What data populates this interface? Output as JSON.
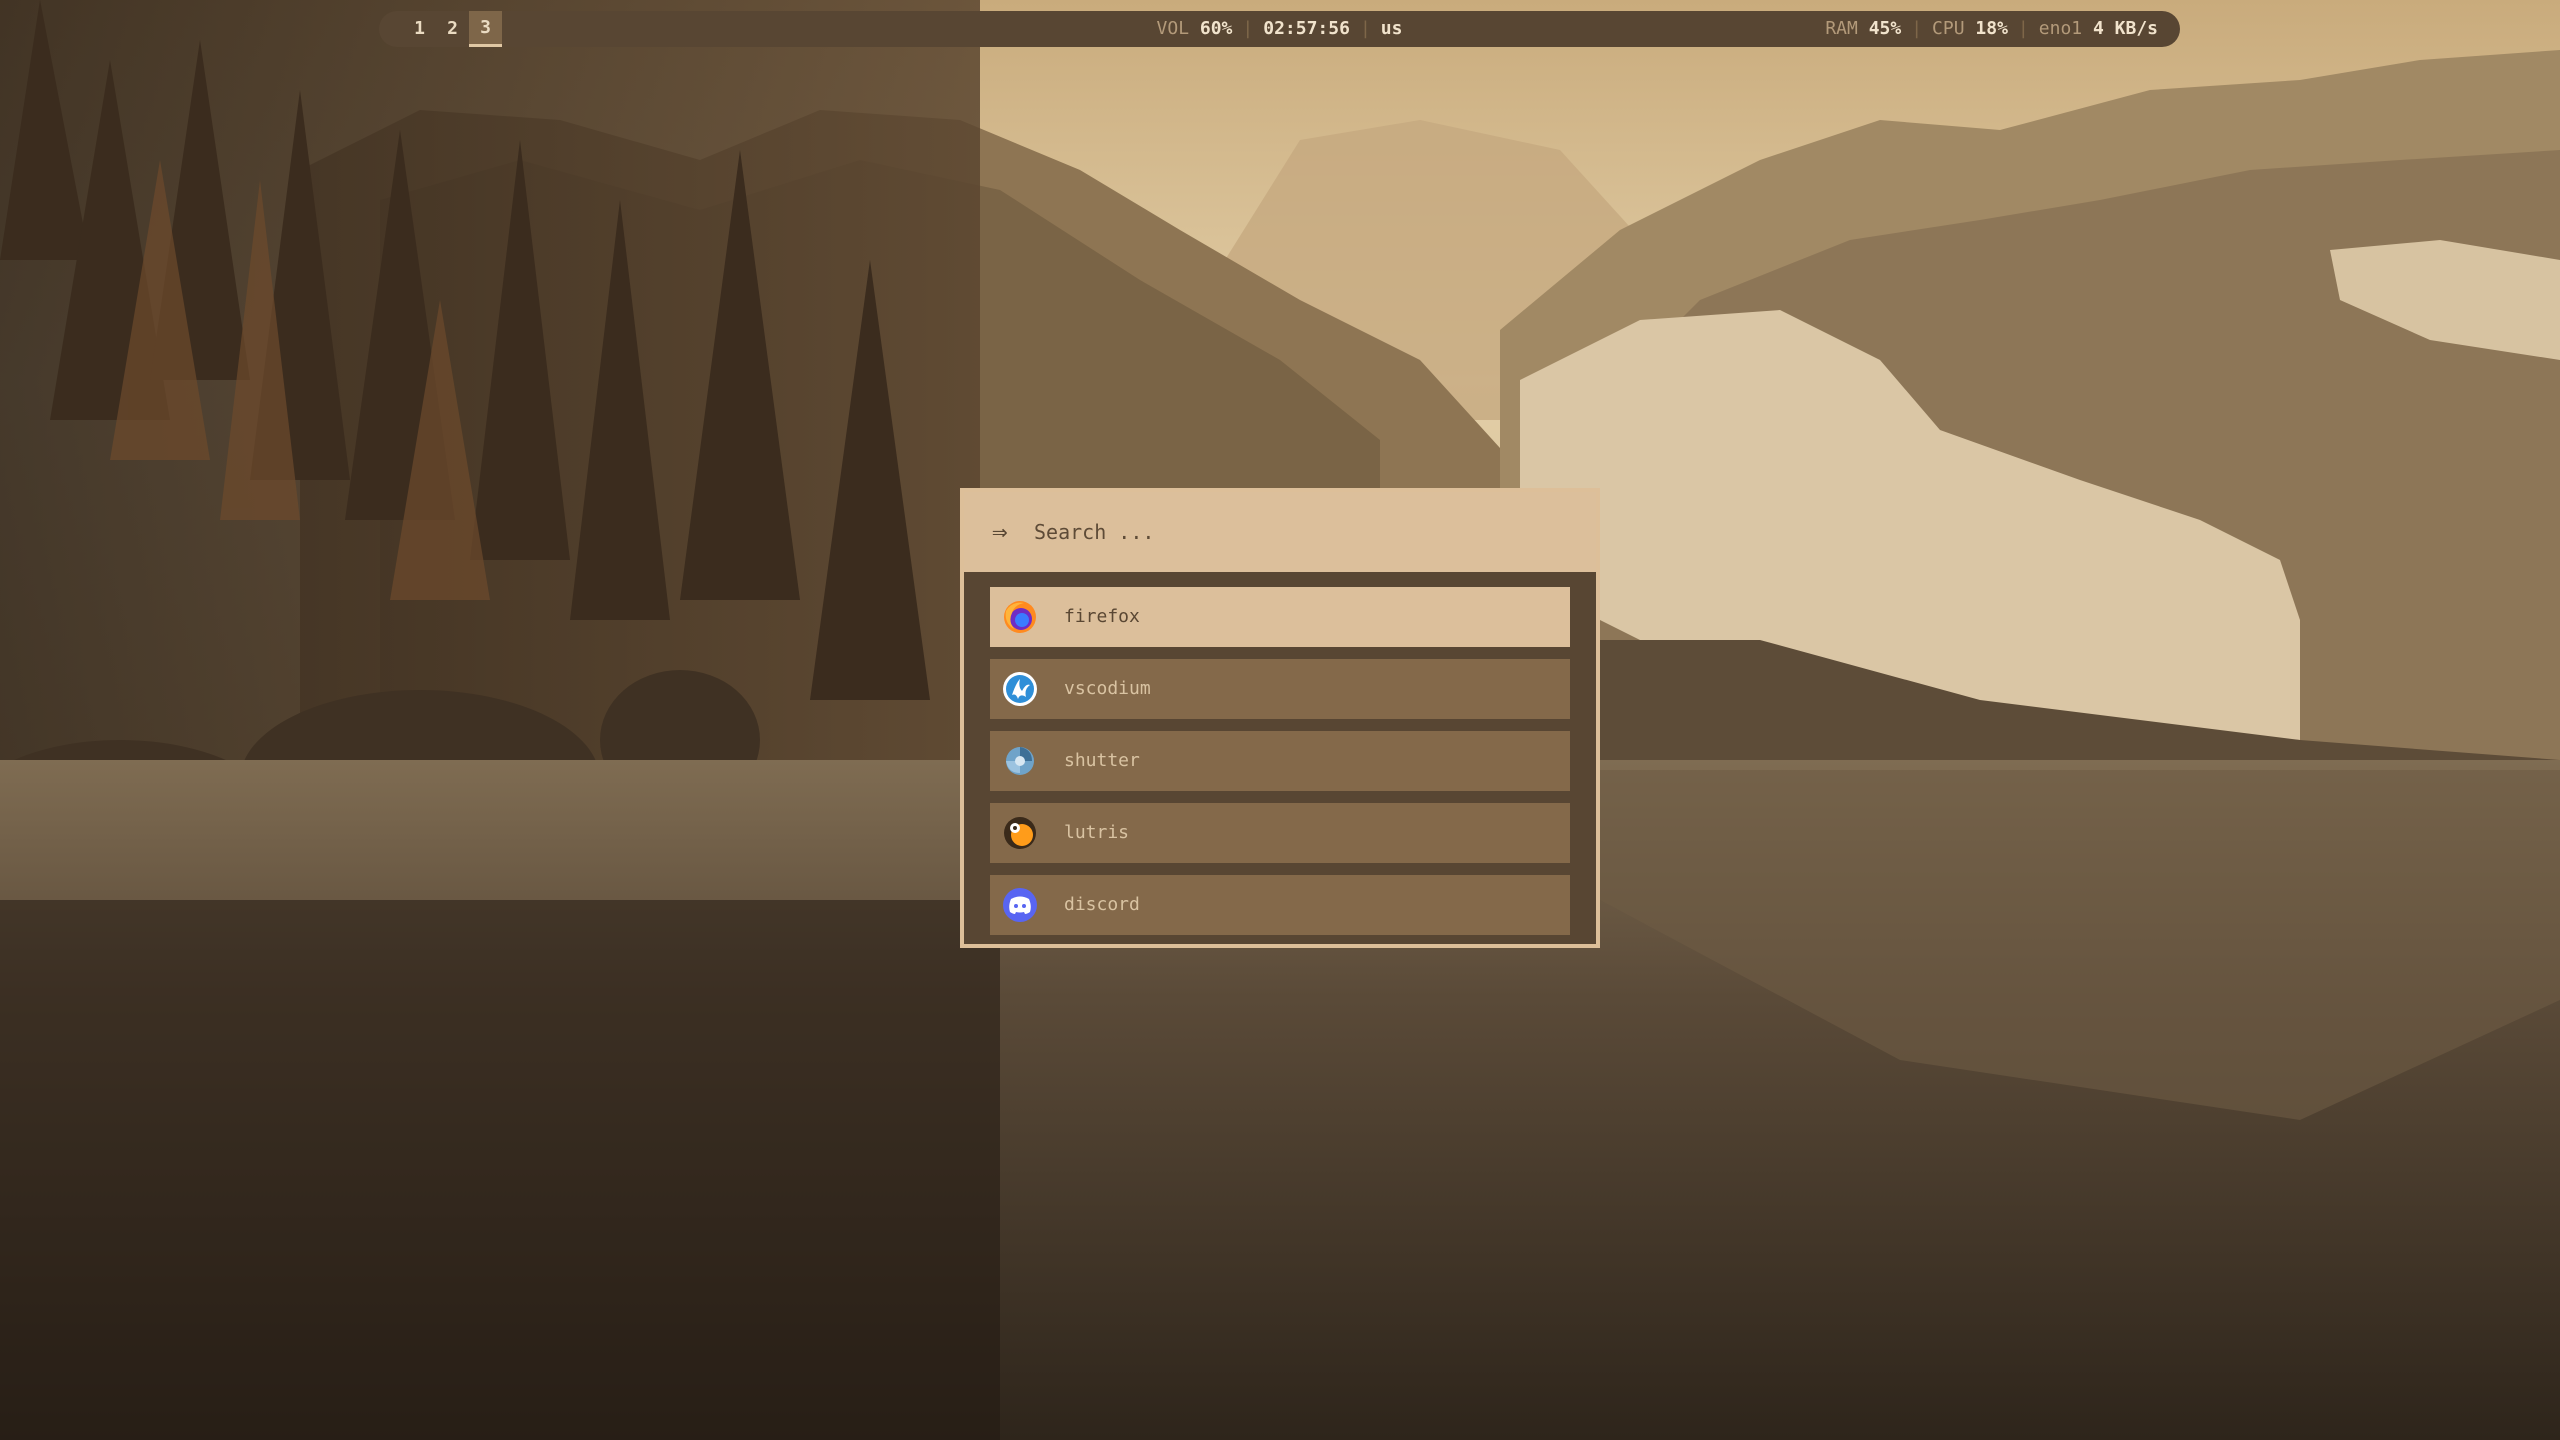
{
  "topbar": {
    "workspaces": [
      {
        "label": "1",
        "active": false
      },
      {
        "label": "2",
        "active": false
      },
      {
        "label": "3",
        "active": true
      }
    ],
    "volume": {
      "label": "VOL",
      "value": "60%"
    },
    "clock": "02:57:56",
    "keyboard_layout": "us",
    "ram": {
      "label": "RAM",
      "value": "45%"
    },
    "cpu": {
      "label": "CPU",
      "value": "18%"
    },
    "network": {
      "label": "eno1",
      "value": "4 KB/s"
    }
  },
  "launcher": {
    "prompt_icon": "⇒",
    "search_placeholder": "Search ...",
    "search_value": "",
    "results": [
      {
        "label": "firefox",
        "icon": "firefox-icon",
        "selected": true
      },
      {
        "label": "vscodium",
        "icon": "vscodium-icon",
        "selected": false
      },
      {
        "label": "shutter",
        "icon": "shutter-icon",
        "selected": false
      },
      {
        "label": "lutris",
        "icon": "lutris-icon",
        "selected": false
      },
      {
        "label": "discord",
        "icon": "discord-icon",
        "selected": false
      }
    ]
  },
  "colors": {
    "bar_bg": "#584633",
    "accent": "#dcbf9b",
    "item_bg": "#84694a",
    "text_light": "#f1e3cc"
  }
}
